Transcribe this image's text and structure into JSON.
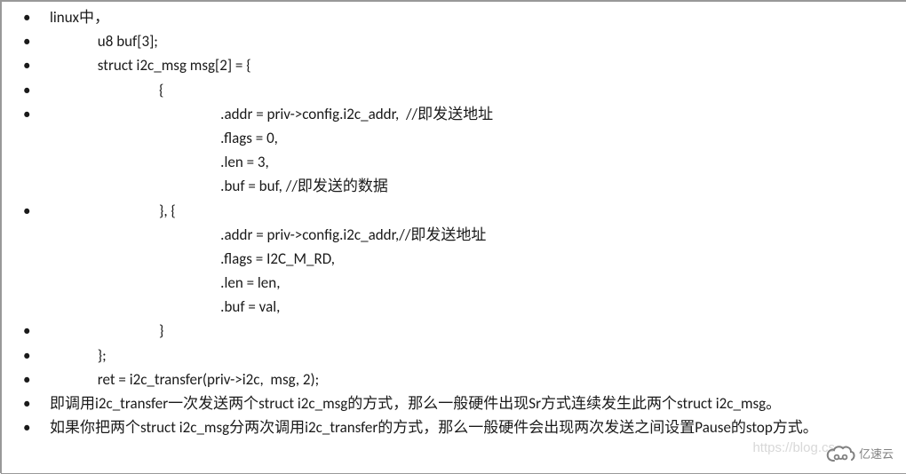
{
  "lines": [
    "linux中，",
    "              u8 buf[3];",
    "              struct i2c_msg msg[2] = {",
    "                                {",
    "                                                  .addr = priv->config.i2c_addr,  //即发送地址",
    "                                                  .flags = 0,",
    "                                                  .len = 3,",
    "                                                  .buf = buf, //即发送的数据",
    "                                }, {",
    "                                                  .addr = priv->config.i2c_addr,//即发送地址",
    "                                                  .flags = I2C_M_RD,",
    "                                                  .len = len,",
    "                                                  .buf = val,",
    "                                }",
    "              };",
    "              ret = i2c_transfer(priv->i2c,  msg, 2);"
  ],
  "para1": "即调用i2c_transfer一次发送两个struct  i2c_msg的方式，那么一般硬件出现Sr方式连续发生此两个struct  i2c_msg。",
  "para2": "如果你把两个struct  i2c_msg分两次调用i2c_transfer的方式，那么一般硬件会出现两次发送之间设置Pause的stop方式。",
  "watermark": "https://blog.cs",
  "logo_text": "亿速云"
}
